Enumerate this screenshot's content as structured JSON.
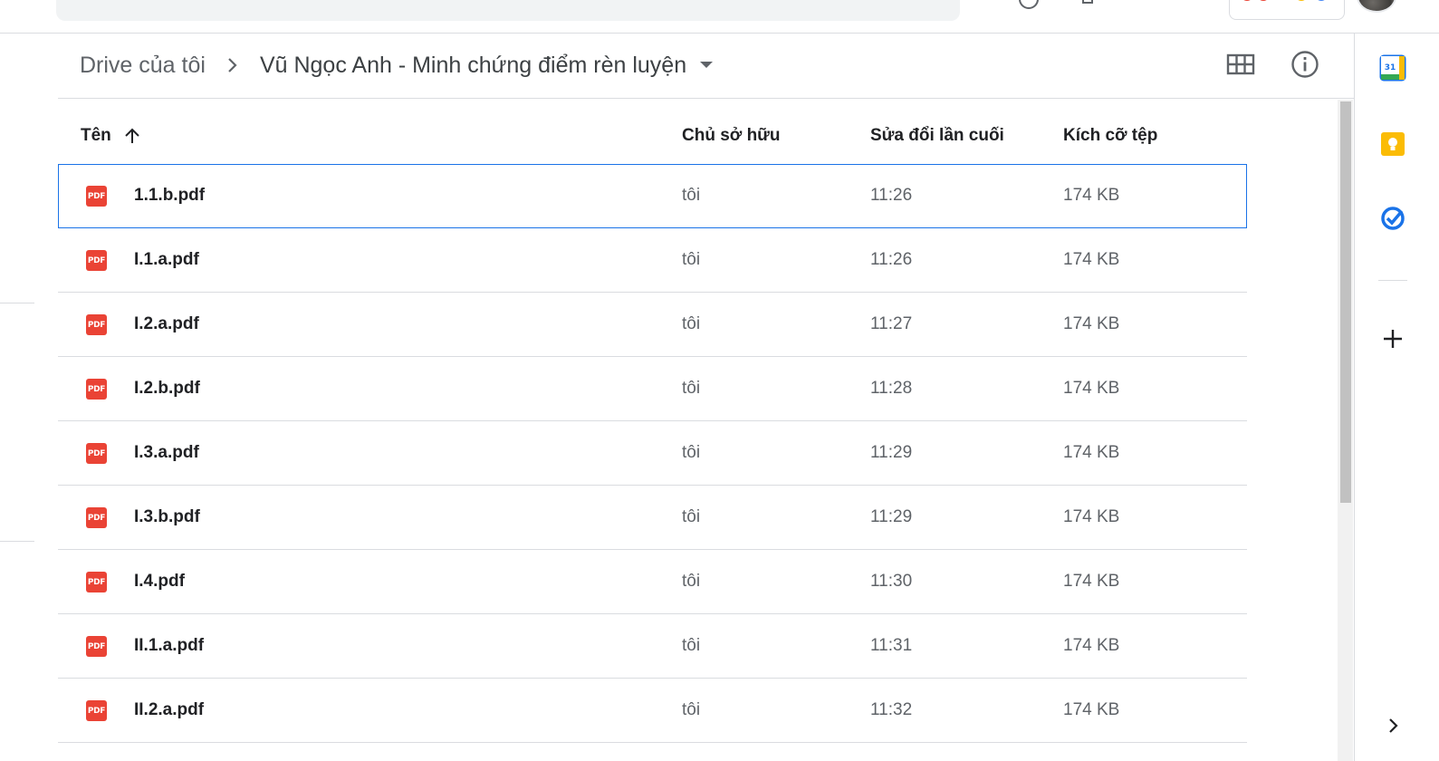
{
  "breadcrumb": {
    "root": "Drive của tôi",
    "current": "Vũ Ngọc Anh - Minh chứng điểm rèn luyện"
  },
  "table": {
    "headers": {
      "name": "Tên",
      "owner": "Chủ sở hữu",
      "modified": "Sửa đổi lần cuối",
      "size": "Kích cỡ tệp"
    },
    "sort": "name-ascending",
    "rows": [
      {
        "name": "1.1.b.pdf",
        "owner": "tôi",
        "modified": "11:26",
        "size": "174 KB",
        "selected": true
      },
      {
        "name": "I.1.a.pdf",
        "owner": "tôi",
        "modified": "11:26",
        "size": "174 KB"
      },
      {
        "name": "I.2.a.pdf",
        "owner": "tôi",
        "modified": "11:27",
        "size": "174 KB"
      },
      {
        "name": "I.2.b.pdf",
        "owner": "tôi",
        "modified": "11:28",
        "size": "174 KB"
      },
      {
        "name": "I.3.a.pdf",
        "owner": "tôi",
        "modified": "11:29",
        "size": "174 KB"
      },
      {
        "name": "I.3.b.pdf",
        "owner": "tôi",
        "modified": "11:29",
        "size": "174 KB"
      },
      {
        "name": "I.4.pdf",
        "owner": "tôi",
        "modified": "11:30",
        "size": "174 KB"
      },
      {
        "name": "II.1.a.pdf",
        "owner": "tôi",
        "modified": "11:31",
        "size": "174 KB"
      },
      {
        "name": "II.2.a.pdf",
        "owner": "tôi",
        "modified": "11:32",
        "size": "174 KB"
      }
    ],
    "file_icon": {
      "name": "pdf-icon",
      "label": "PDF",
      "color": "#ea4335"
    }
  },
  "icons": {
    "grid_view": "grid-view-icon",
    "info": "info-icon",
    "sort": "arrow-up-icon",
    "dropdown": "caret-down-icon",
    "separator": "chevron-right-icon"
  },
  "side_panel": {
    "calendar_day": "31",
    "items": [
      "calendar-icon",
      "keep-icon",
      "tasks-icon",
      "add-icon",
      "chevron-right-icon"
    ]
  },
  "colors": {
    "selection": "#1a73e8",
    "pdf": "#ea4335",
    "calendar": "#1a73e8",
    "keep": "#fbbc04",
    "tasks": "#1a73e8"
  }
}
